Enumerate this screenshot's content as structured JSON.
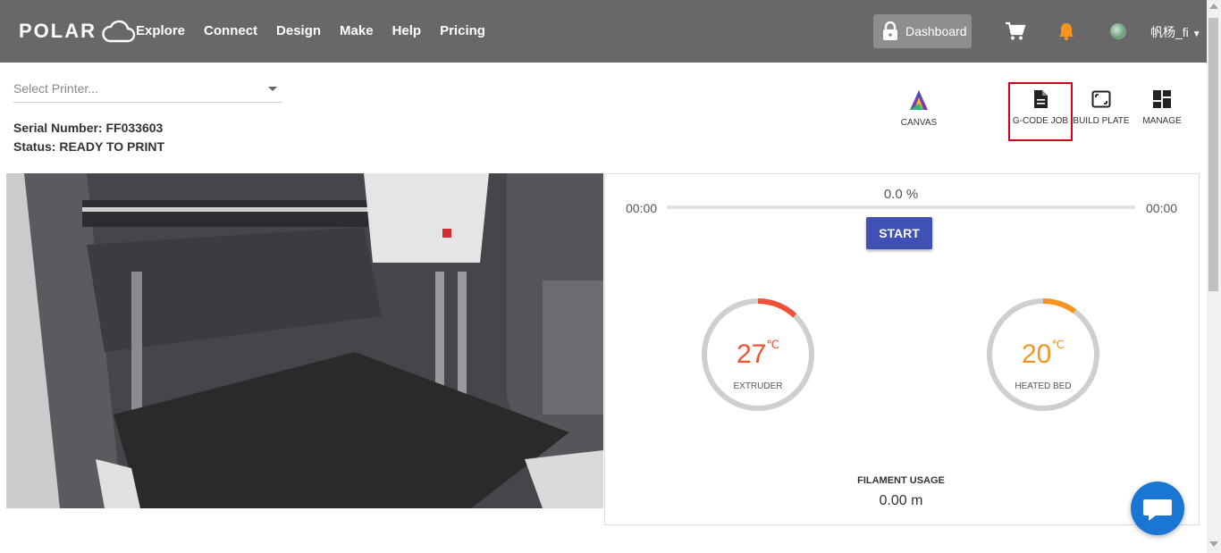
{
  "brand": {
    "name": "POLAR"
  },
  "nav": {
    "items": [
      "Explore",
      "Connect",
      "Design",
      "Make",
      "Help",
      "Pricing"
    ]
  },
  "header": {
    "dashboard_label": "Dashboard",
    "username": "帆杨_fi"
  },
  "printer": {
    "select_placeholder": "Select Printer...",
    "serial": "Serial Number: FF033603",
    "status": "Status: READY TO PRINT"
  },
  "toolbar": {
    "canvas": "CANVAS",
    "gcode_job": "G-CODE JOB",
    "build_plate": "BUILD PLATE",
    "manage": "MANAGE"
  },
  "progress": {
    "elapsed": "00:00",
    "remaining": "00:00",
    "percent_label": "0.0 %",
    "percent_value": 0
  },
  "controls": {
    "start_label": "START"
  },
  "gauges": {
    "extruder": {
      "value": "27",
      "unit": "℃",
      "label": "EXTRUDER",
      "color": "#f05033"
    },
    "heated_bed": {
      "value": "20",
      "unit": "℃",
      "label": "HEATED BED",
      "color": "#f7941d"
    }
  },
  "filament": {
    "title": "FILAMENT USAGE",
    "value": "0.00 m"
  },
  "colors": {
    "topbar": "#68686b",
    "primary": "#3f51b5",
    "highlight": "#d0021b",
    "chat": "#1976d2"
  }
}
